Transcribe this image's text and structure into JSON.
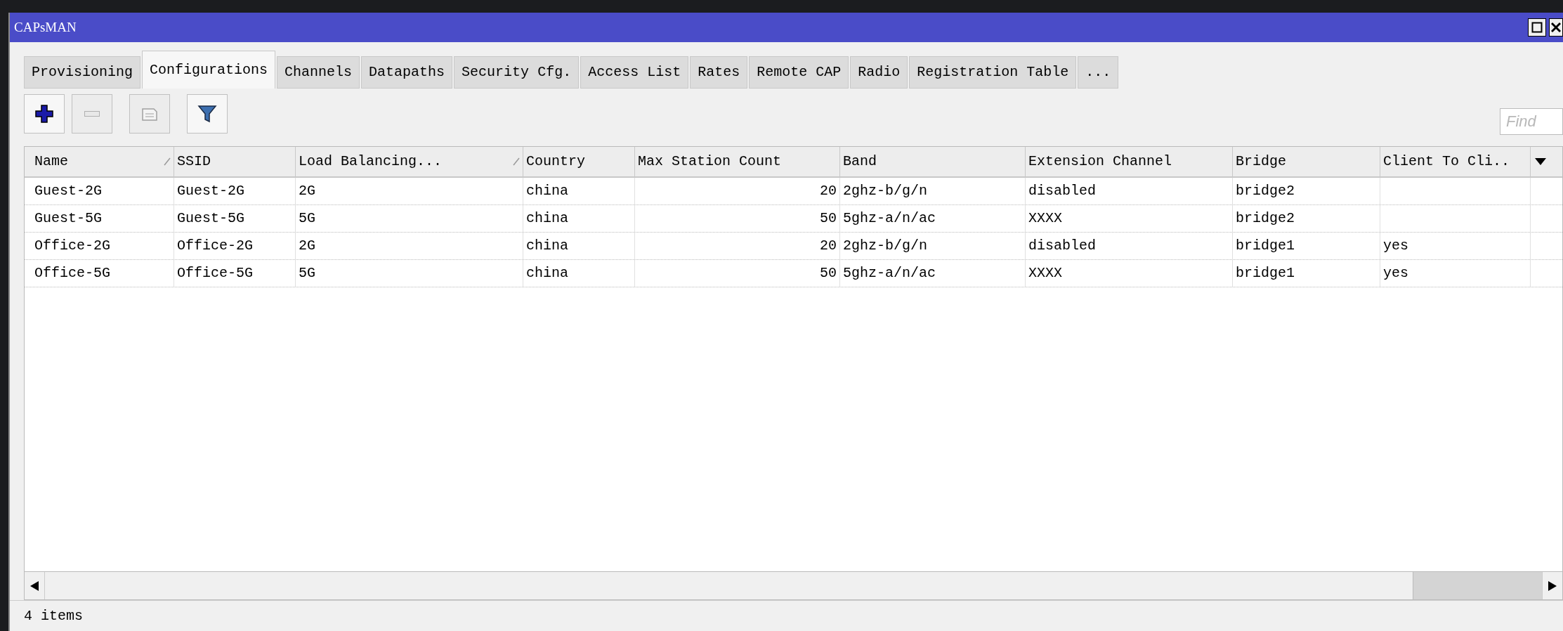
{
  "window": {
    "title": "CAPsMAN"
  },
  "tabs": [
    {
      "label": "Provisioning",
      "selected": false
    },
    {
      "label": "Configurations",
      "selected": true
    },
    {
      "label": "Channels",
      "selected": false
    },
    {
      "label": "Datapaths",
      "selected": false
    },
    {
      "label": "Security Cfg.",
      "selected": false
    },
    {
      "label": "Access List",
      "selected": false
    },
    {
      "label": "Rates",
      "selected": false
    },
    {
      "label": "Remote CAP",
      "selected": false
    },
    {
      "label": "Radio",
      "selected": false
    },
    {
      "label": "Registration Table",
      "selected": false
    },
    {
      "label": "...",
      "selected": false
    }
  ],
  "toolbar": [
    {
      "kind": "add",
      "disabled": false
    },
    {
      "kind": "remove",
      "disabled": true
    },
    {
      "kind": "comment",
      "disabled": true
    },
    {
      "kind": "filter",
      "disabled": false
    }
  ],
  "search": {
    "placeholder": "Find"
  },
  "table": {
    "columns": [
      {
        "label": "Name",
        "sorted": true
      },
      {
        "label": "SSID",
        "sorted": false
      },
      {
        "label": "Load Balancing...",
        "sorted": true
      },
      {
        "label": "Country",
        "sorted": false
      },
      {
        "label": "Max Station Count",
        "sorted": false
      },
      {
        "label": "Band",
        "sorted": false
      },
      {
        "label": "Extension Channel",
        "sorted": false
      },
      {
        "label": "Bridge",
        "sorted": false
      },
      {
        "label": "Client To Cli..",
        "sorted": false
      }
    ],
    "rows": [
      [
        "Guest-2G",
        "Guest-2G",
        "2G",
        "china",
        "20",
        "2ghz-b/g/n",
        "disabled",
        "bridge2",
        ""
      ],
      [
        "Guest-5G",
        "Guest-5G",
        "5G",
        "china",
        "50",
        "5ghz-a/n/ac",
        "XXXX",
        "bridge2",
        ""
      ],
      [
        "Office-2G",
        "Office-2G",
        "2G",
        "china",
        "20",
        "2ghz-b/g/n",
        "disabled",
        "bridge1",
        "yes"
      ],
      [
        "Office-5G",
        "Office-5G",
        "5G",
        "china",
        "50",
        "5ghz-a/n/ac",
        "XXXX",
        "bridge1",
        "yes"
      ]
    ]
  },
  "status_bar": {
    "text": "4 items"
  }
}
